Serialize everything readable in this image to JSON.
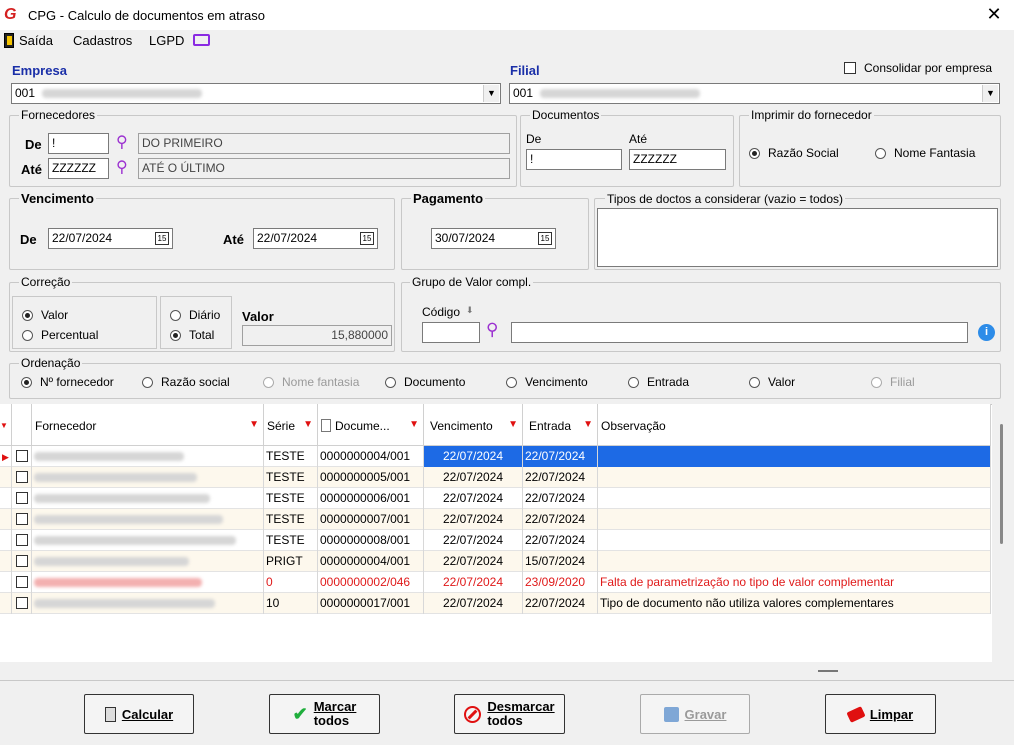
{
  "window": {
    "title": "CPG - Calculo de documentos em atraso"
  },
  "menu": {
    "saida": "Saída",
    "cadastros": "Cadastros",
    "lgpd": "LGPD"
  },
  "empresa": {
    "label": "Empresa",
    "value": "001"
  },
  "filial": {
    "label": "Filial",
    "value": "001"
  },
  "consolidar": {
    "label": "Consolidar por empresa"
  },
  "fornecedores": {
    "title": "Fornecedores",
    "de_label": "De",
    "de_value": "!",
    "de_desc": "DO PRIMEIRO",
    "ate_label": "Até",
    "ate_value": "ZZZZZZ",
    "ate_desc": "ATÉ O ÚLTIMO"
  },
  "documentos": {
    "title": "Documentos",
    "de_label": "De",
    "ate_label": "Até",
    "de_value": "!",
    "ate_value": "ZZZZZZ"
  },
  "imprimir": {
    "title": "Imprimir do fornecedor",
    "opt1": "Razão Social",
    "opt2": "Nome Fantasia"
  },
  "vencimento": {
    "title": "Vencimento",
    "de_label": "De",
    "de_value": "22/07/2024",
    "ate_label": "Até",
    "ate_value": "22/07/2024"
  },
  "pagamento": {
    "title": "Pagamento",
    "value": "30/07/2024"
  },
  "tipos": {
    "title": "Tipos de doctos a considerar (vazio = todos)"
  },
  "correcao": {
    "title": "Correção",
    "valor": "Valor",
    "percentual": "Percentual",
    "diario": "Diário",
    "total": "Total",
    "valor_label": "Valor",
    "valor_value": "15,880000"
  },
  "grupo": {
    "title": "Grupo de Valor compl.",
    "codigo_label": "Código"
  },
  "ordenacao": {
    "title": "Ordenação",
    "opts": [
      "Nº fornecedor",
      "Razão social",
      "Nome fantasia",
      "Documento",
      "Vencimento",
      "Entrada",
      "Valor",
      "Filial"
    ]
  },
  "grid": {
    "headers": {
      "fornecedor": "Fornecedor",
      "serie": "Série",
      "documento": "Docume...",
      "vencimento": "Vencimento",
      "entrada": "Entrada",
      "observacao": "Observação"
    },
    "rows": [
      {
        "serie": "TESTE",
        "doc": "0000000004/001",
        "venc": "22/07/2024",
        "entrada": "22/07/2024",
        "obs": ""
      },
      {
        "serie": "TESTE",
        "doc": "0000000005/001",
        "venc": "22/07/2024",
        "entrada": "22/07/2024",
        "obs": ""
      },
      {
        "serie": "TESTE",
        "doc": "0000000006/001",
        "venc": "22/07/2024",
        "entrada": "22/07/2024",
        "obs": ""
      },
      {
        "serie": "TESTE",
        "doc": "0000000007/001",
        "venc": "22/07/2024",
        "entrada": "22/07/2024",
        "obs": ""
      },
      {
        "serie": "TESTE",
        "doc": "0000000008/001",
        "venc": "22/07/2024",
        "entrada": "22/07/2024",
        "obs": ""
      },
      {
        "serie": "PRIGT",
        "doc": "0000000004/001",
        "venc": "22/07/2024",
        "entrada": "15/07/2024",
        "obs": ""
      },
      {
        "serie": "0",
        "doc": "0000000002/046",
        "venc": "22/07/2024",
        "entrada": "23/09/2020",
        "obs": "Falta de parametrização no tipo de valor complementar"
      },
      {
        "serie": "10",
        "doc": "0000000017/001",
        "venc": "22/07/2024",
        "entrada": "22/07/2024",
        "obs": "Tipo de documento não utiliza valores complementares"
      }
    ]
  },
  "buttons": {
    "calcular": "Calcular",
    "marcar_1": "Marcar",
    "marcar_2": "todos",
    "desmarcar_1": "Desmarcar",
    "desmarcar_2": "todos",
    "gravar": "Gravar",
    "limpar": "Limpar"
  }
}
